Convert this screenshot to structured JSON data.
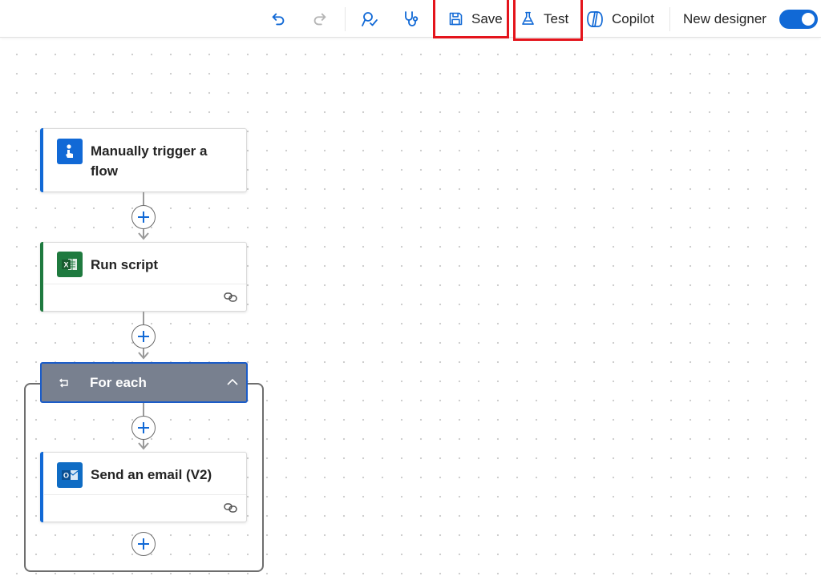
{
  "toolbar": {
    "undo_icon": "undo-icon",
    "redo_icon": "redo-icon",
    "flow_checker_icon": "flow-checker-icon",
    "health_icon": "stethoscope-icon",
    "save_label": "Save",
    "test_label": "Test",
    "copilot_label": "Copilot",
    "new_designer_label": "New designer",
    "new_designer_enabled": true
  },
  "flow": {
    "trigger": {
      "title_line1": "Manually trigger a",
      "title_line2": "flow",
      "icon": "manual-trigger-icon",
      "accent": "#1169d6"
    },
    "run_script": {
      "title": "Run script",
      "icon": "excel-icon",
      "accent": "#1f7a3f"
    },
    "for_each": {
      "title": "For each",
      "icon": "loop-icon",
      "header_color": "#78808f"
    },
    "send_email": {
      "title": "Send an email (V2)",
      "icon": "outlook-icon",
      "accent": "#1169d6"
    }
  },
  "colors": {
    "highlight": "#e4141c",
    "accent_blue": "#1169d6"
  }
}
